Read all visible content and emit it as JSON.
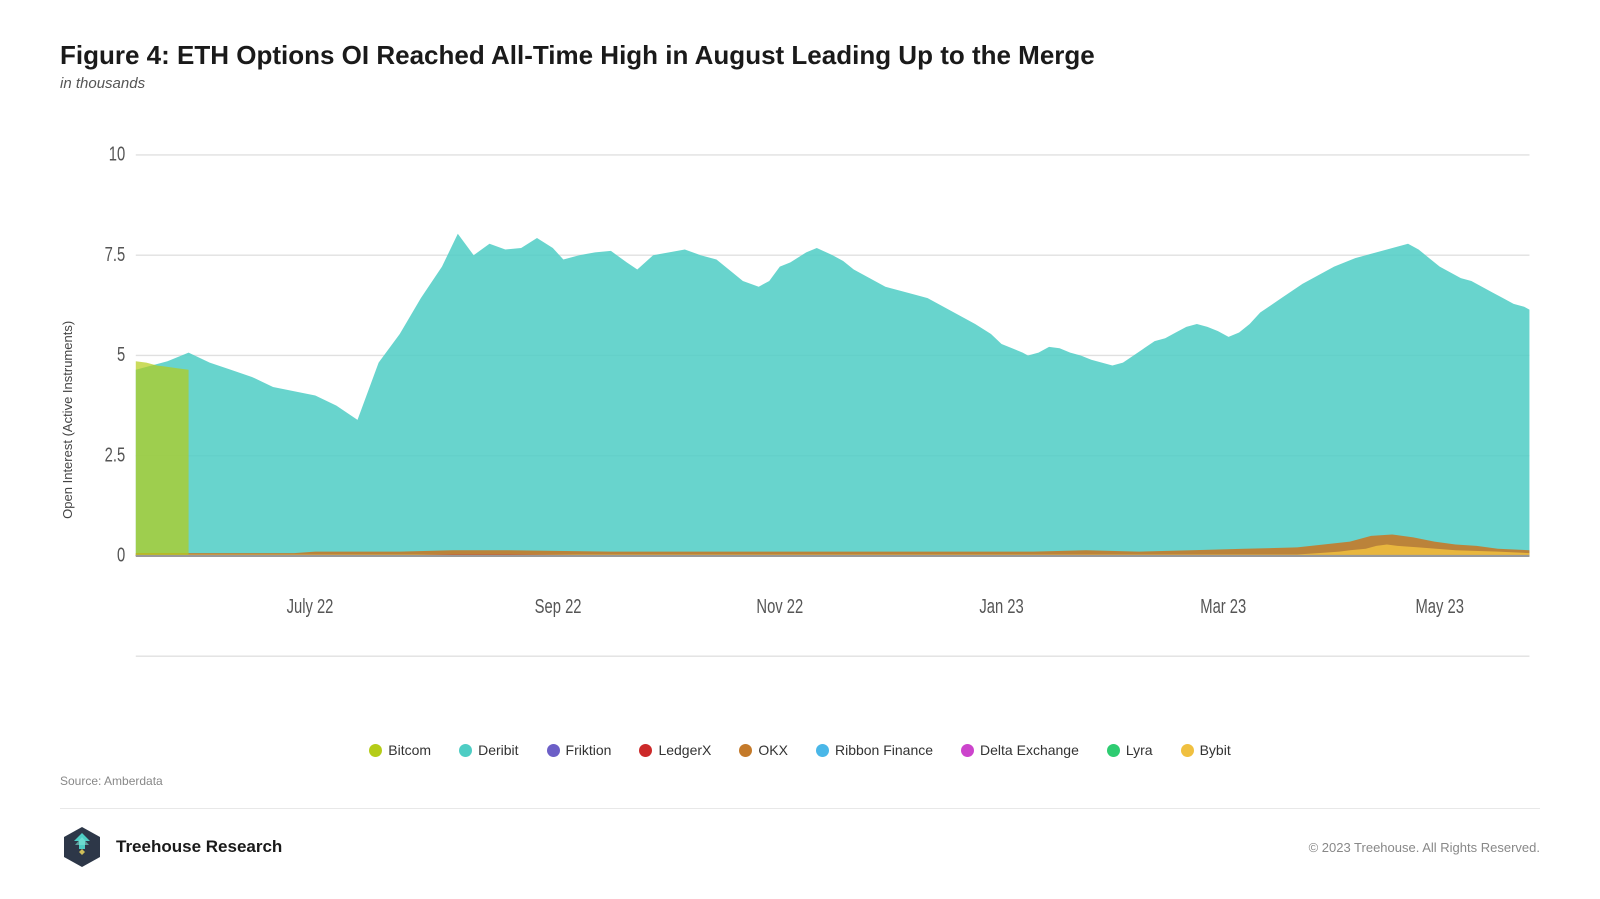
{
  "page": {
    "title": "Figure 4: ETH Options OI Reached All-Time High in August Leading Up to the Merge",
    "subtitle": "in thousands",
    "y_axis_label": "Open Interest (Active Instruments)",
    "source": "Source: Amberdata",
    "footer": {
      "brand": "Treehouse Research",
      "copyright": "© 2023 Treehouse. All Rights Reserved."
    },
    "x_axis": [
      "July 22",
      "Sep 22",
      "Nov 22",
      "Jan 23",
      "Mar 23",
      "May 23"
    ],
    "y_axis": [
      "10",
      "7.5",
      "5",
      "2.5",
      "0"
    ],
    "legend": [
      {
        "name": "Bitcom",
        "color": "#b5cc18"
      },
      {
        "name": "Deribit",
        "color": "#4ecdc4"
      },
      {
        "name": "Friktion",
        "color": "#6c5fc7"
      },
      {
        "name": "LedgerX",
        "color": "#cc2929"
      },
      {
        "name": "OKX",
        "color": "#c47a2a"
      },
      {
        "name": "Ribbon Finance",
        "color": "#4ab7e8"
      },
      {
        "name": "Delta Exchange",
        "color": "#cc44cc"
      },
      {
        "name": "Lyra",
        "color": "#2ecc71"
      },
      {
        "name": "Bybit",
        "color": "#f0c040"
      }
    ]
  }
}
